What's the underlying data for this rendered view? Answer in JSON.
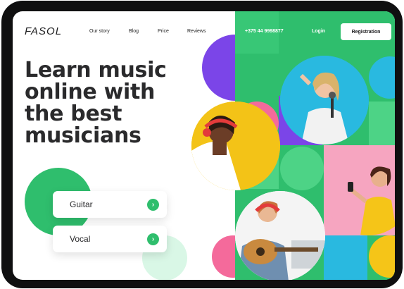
{
  "header": {
    "logo": "FASOL",
    "nav": [
      "Our story",
      "Blog",
      "Price",
      "Reviews"
    ],
    "phone": "+375 44 9998877",
    "login_label": "Login",
    "register_label": "Registration"
  },
  "hero": {
    "lines": [
      "Learn music",
      "online with",
      "the best",
      "musicians"
    ]
  },
  "courses": [
    {
      "label": "Guitar",
      "arrow": "›"
    },
    {
      "label": "Vocal",
      "arrow": "›"
    }
  ],
  "colors": {
    "accent": "#2fbe6d",
    "purple": "#7b45e8",
    "pink": "#f46a9b",
    "yellow": "#f5c518",
    "blue": "#29b9e0"
  }
}
